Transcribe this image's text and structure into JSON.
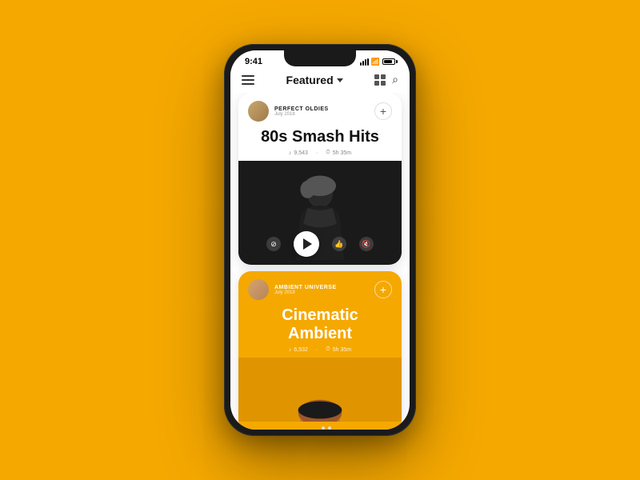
{
  "background_color": "#F5A800",
  "status_bar": {
    "time": "9:41"
  },
  "header": {
    "title": "Featured",
    "menu_label": "menu",
    "search_label": "search",
    "grid_label": "grid-view"
  },
  "cards": [
    {
      "id": "card-1",
      "author_name": "PERFECT OLDIES",
      "author_date": "July 2018",
      "title": "80s Smash Hits",
      "stats_followers": "9,543",
      "stats_duration": "5h 35m",
      "add_button_label": "+"
    },
    {
      "id": "card-2",
      "author_name": "AMBIENT UNIVERSE",
      "author_date": "July 2018",
      "title": "Cinematic Ambient",
      "stats_followers": "6,532",
      "stats_duration": "5h 35m",
      "add_button_label": "+"
    }
  ],
  "controls": {
    "ban_label": "ban",
    "play_label": "play",
    "like_label": "like",
    "mute_label": "mute"
  }
}
